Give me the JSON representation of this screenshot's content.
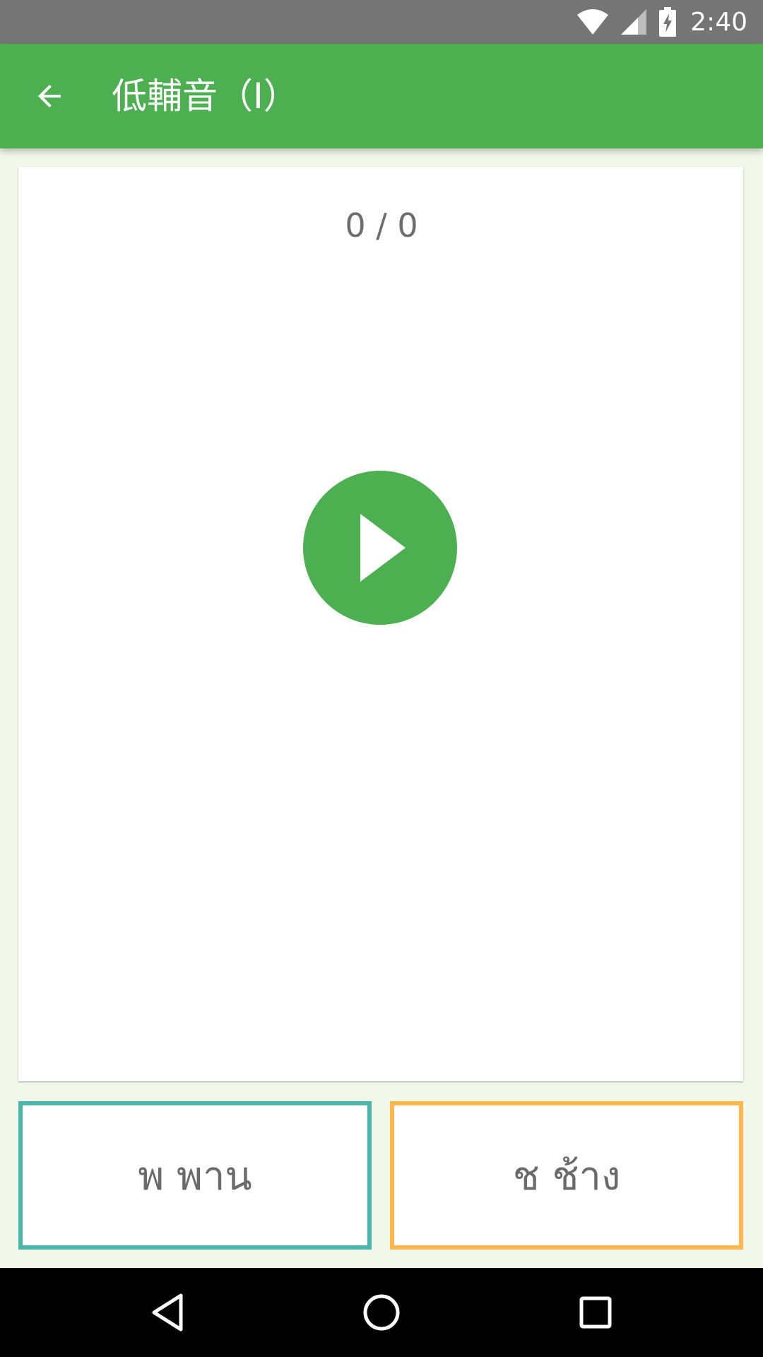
{
  "status_bar": {
    "time": "2:40",
    "icons": [
      "wifi-icon",
      "cell-signal-icon",
      "battery-charging-icon"
    ]
  },
  "app_bar": {
    "back_icon": "arrow-back-icon",
    "title": "低輔音（I）"
  },
  "card": {
    "progress": "0 / 0",
    "play_icon": "play-icon"
  },
  "answers": [
    {
      "label": "พ พาน",
      "border_color": "#4db6ac"
    },
    {
      "label": "ช ช้าง",
      "border_color": "#ffb74d"
    }
  ],
  "nav_bar": {
    "icons": [
      "back-triangle-icon",
      "home-circle-icon",
      "recents-square-icon"
    ]
  },
  "colors": {
    "primary": "#4caf50",
    "status_bar": "#757575",
    "background": "#f1f8e9"
  }
}
